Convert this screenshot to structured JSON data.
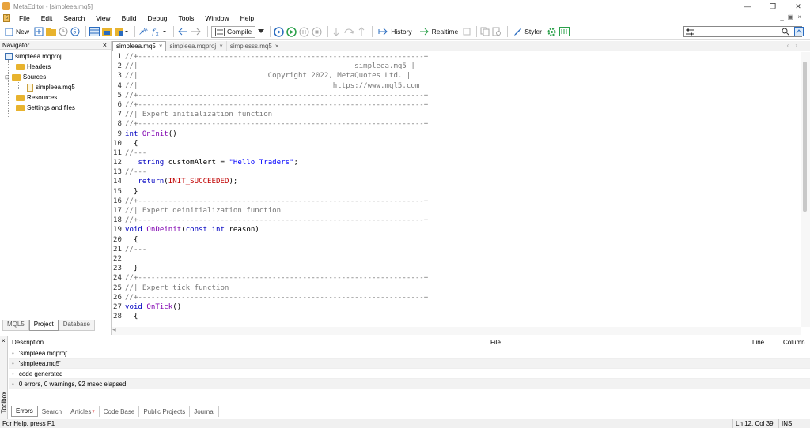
{
  "window": {
    "title": "MetaEditor - [simpleea.mq5]"
  },
  "menu": [
    "File",
    "Edit",
    "Search",
    "View",
    "Build",
    "Debug",
    "Tools",
    "Window",
    "Help"
  ],
  "toolbar": {
    "new": "New",
    "compile": "Compile",
    "history": "History",
    "realtime": "Realtime",
    "styler": "Styler",
    "search_value": ""
  },
  "navigator": {
    "title": "Navigator",
    "project": "simpleea.mqproj",
    "items": [
      "Headers",
      "Sources",
      "simpleea.mq5",
      "Resources",
      "Settings and files"
    ],
    "tabs": [
      "MQL5",
      "Project",
      "Database"
    ]
  },
  "editor": {
    "tabs": [
      "simpleea.mq5",
      "simpleea.mqproj",
      "simplesss.mq5"
    ],
    "lines": [
      "//+------------------------------------------------------------------+",
      "//|                                                  simpleea.mq5 |",
      "//|                              Copyright 2022, MetaQuotes Ltd. |",
      "//|                                             https://www.mql5.com |",
      "//+------------------------------------------------------------------+",
      "//+------------------------------------------------------------------+",
      "//| Expert initialization function                                   |",
      "//+------------------------------------------------------------------+",
      "int OnInit()",
      "  {",
      "//---",
      "   string customAlert = \"Hello Traders\";",
      "//---",
      "   return(INIT_SUCCEEDED);",
      "  }",
      "//+------------------------------------------------------------------+",
      "//| Expert deinitialization function                                 |",
      "//+------------------------------------------------------------------+",
      "void OnDeinit(const int reason)",
      "  {",
      "//---",
      "",
      "  }",
      "//+------------------------------------------------------------------+",
      "//| Expert tick function                                             |",
      "//+------------------------------------------------------------------+",
      "void OnTick()",
      "  {"
    ]
  },
  "toolbox": {
    "side_label": "Toolbox",
    "columns": [
      "Description",
      "File",
      "Line",
      "Column"
    ],
    "rows": [
      "'simpleea.mqproj'",
      "'simpleea.mq5'",
      "code generated",
      "0 errors, 0 warnings, 92 msec elapsed"
    ],
    "tabs": [
      "Errors",
      "Search",
      "Articles",
      "Code Base",
      "Public Projects",
      "Journal"
    ],
    "articles_badge": "7"
  },
  "status": {
    "help": "For Help, press F1",
    "position": "Ln 12, Col 39",
    "mode": "INS"
  }
}
